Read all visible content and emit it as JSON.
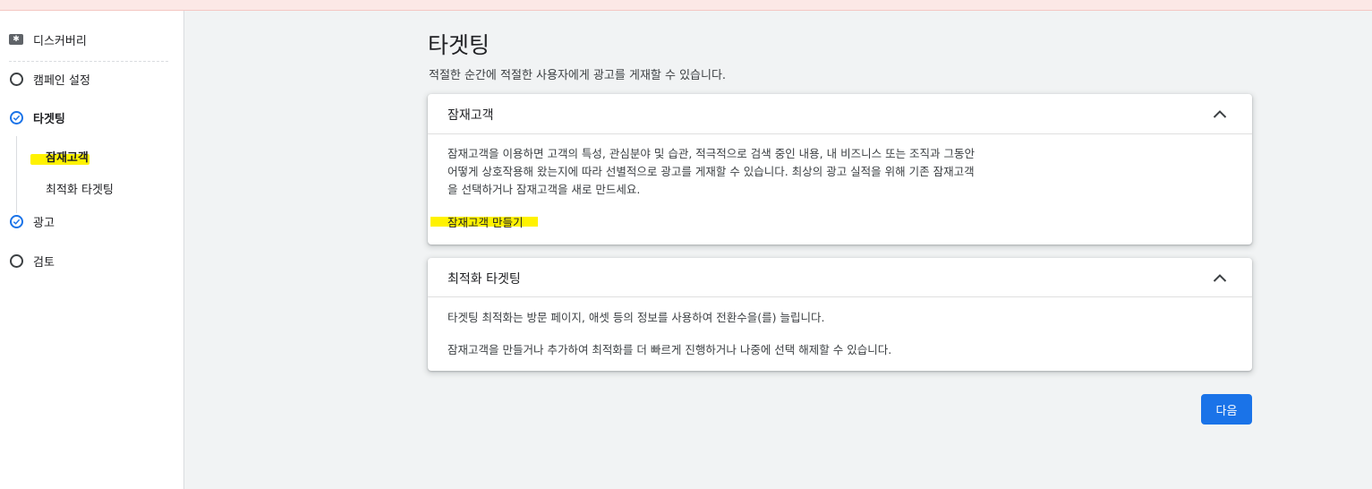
{
  "sidebar": {
    "discovery_label": "디스커버리",
    "items": [
      {
        "label": "캠페인 설정",
        "state": "incomplete"
      },
      {
        "label": "타겟팅",
        "state": "complete",
        "sub": [
          {
            "label": "잠재고객",
            "active": true
          },
          {
            "label": "최적화 타겟팅",
            "active": false
          }
        ]
      },
      {
        "label": "광고",
        "state": "complete"
      },
      {
        "label": "검토",
        "state": "incomplete"
      }
    ]
  },
  "main": {
    "title": "타겟팅",
    "subtitle": "적절한 순간에 적절한 사용자에게 광고를 게재할 수 있습니다."
  },
  "audience_card": {
    "title": "잠재고객",
    "lines": [
      "잠재고객을 이용하면 고객의 특성, 관심분야 및 습관, 적극적으로 검색 중인 내용, 내 비즈니스 또는 조직과 그동안",
      "어떻게 상호작용해 왔는지에 따라 선별적으로 광고를 게재할 수 있습니다. 최상의 광고 실적을 위해 기존 잠재고객",
      "을 선택하거나 잠재고객을 새로 만드세요."
    ],
    "create_link": "잠재고객 만들기"
  },
  "optimized_card": {
    "title": "최적화 타겟팅",
    "line1": "타겟팅 최적화는 방문 페이지, 애셋 등의 정보를 사용하여 전환수을(를) 늘립니다.",
    "line2": "잠재고객을 만들거나 추가하여 최적화를 더 빠르게 진행하거나 나중에 선택 해제할 수 있습니다."
  },
  "next_button": "다음",
  "colors": {
    "accent": "#1a73e8",
    "highlight": "#fff200",
    "background": "#f1f3f4"
  }
}
